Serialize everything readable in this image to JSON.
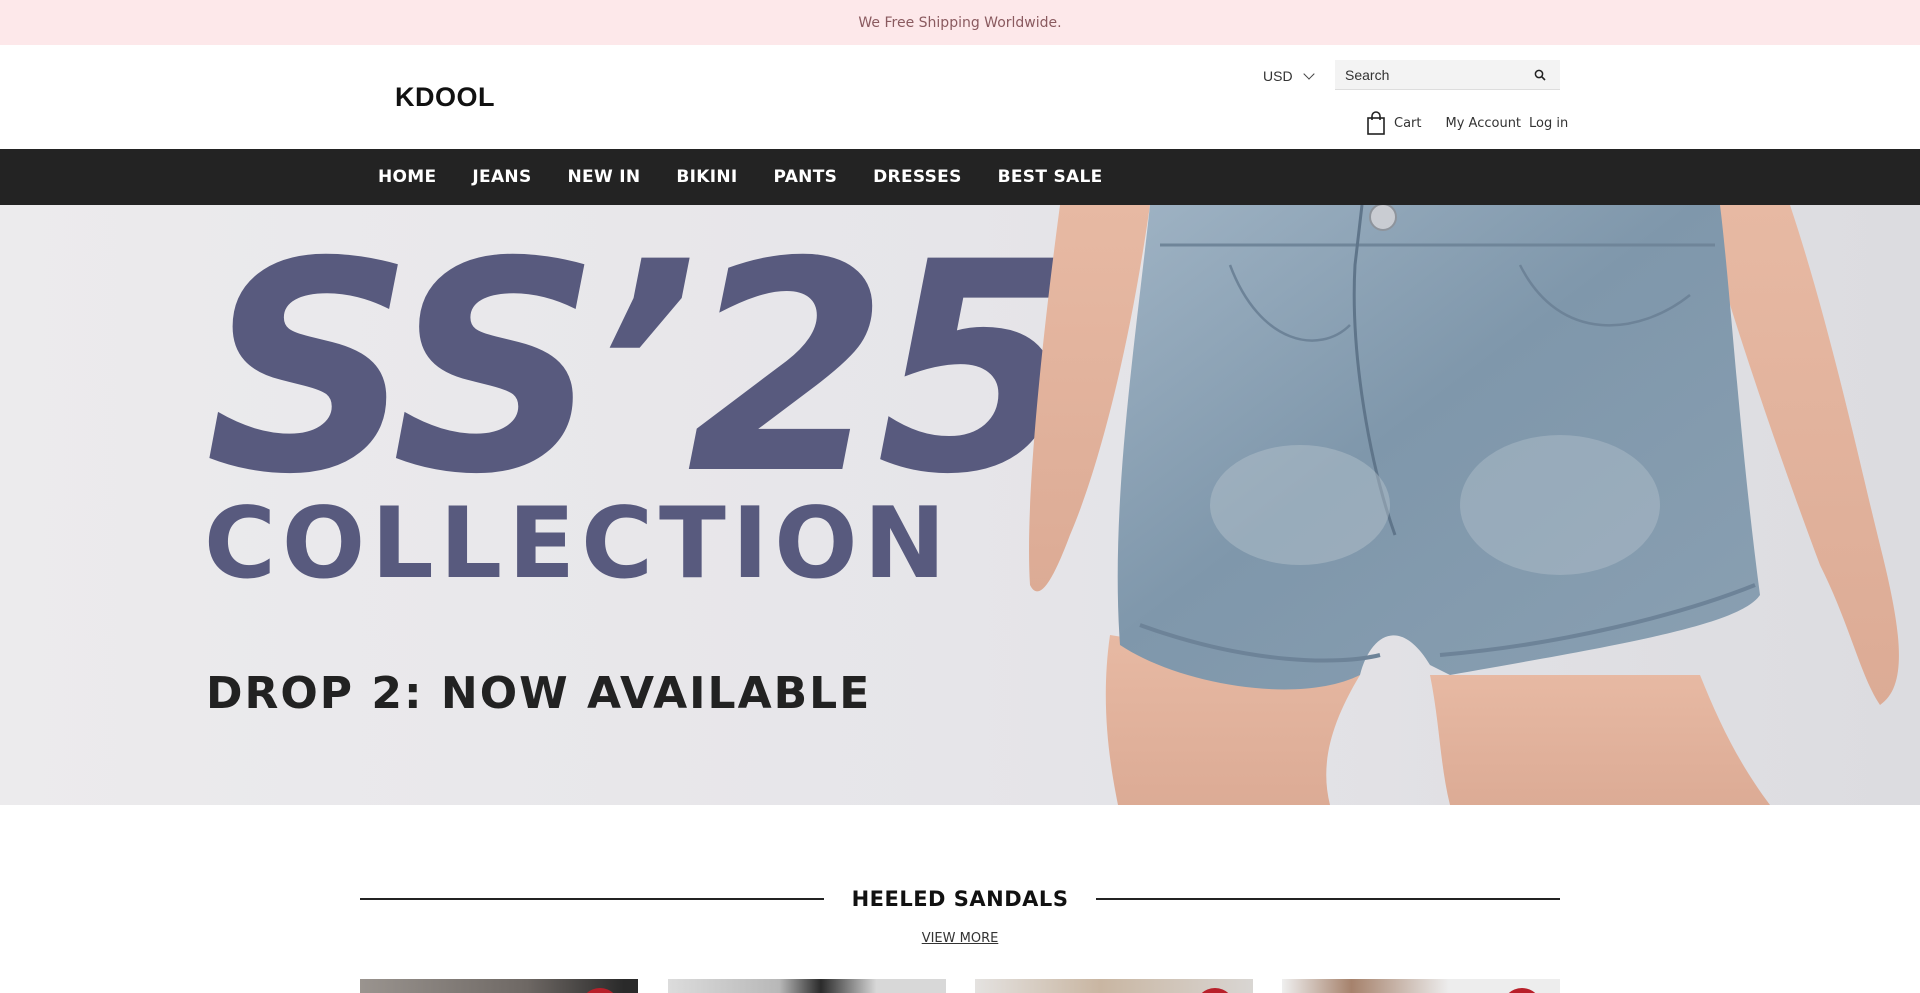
{
  "announcement": {
    "text": "We Free Shipping Worldwide."
  },
  "header": {
    "logo": "KDOOL",
    "currency": "USD",
    "search_placeholder": "Search",
    "cart_label": "Cart",
    "my_account_label": "My Account",
    "login_label": "Log in"
  },
  "nav": {
    "items": [
      {
        "label": "HOME"
      },
      {
        "label": "JEANS"
      },
      {
        "label": "NEW IN"
      },
      {
        "label": "BIKINI"
      },
      {
        "label": "PANTS"
      },
      {
        "label": "DRESSES"
      },
      {
        "label": "BEST SALE"
      }
    ]
  },
  "hero": {
    "headline": "SS’25",
    "subheadline": "COLLECTION",
    "tagline": "DROP 2: NOW AVAILABLE"
  },
  "section": {
    "title": "HEELED SANDALS",
    "view_more": "VIEW MORE"
  },
  "colors": {
    "announcement_bg": "#fde8ea",
    "nav_bg": "#232323",
    "hero_text": "#585a7e",
    "sale_badge": "#b8202a"
  }
}
